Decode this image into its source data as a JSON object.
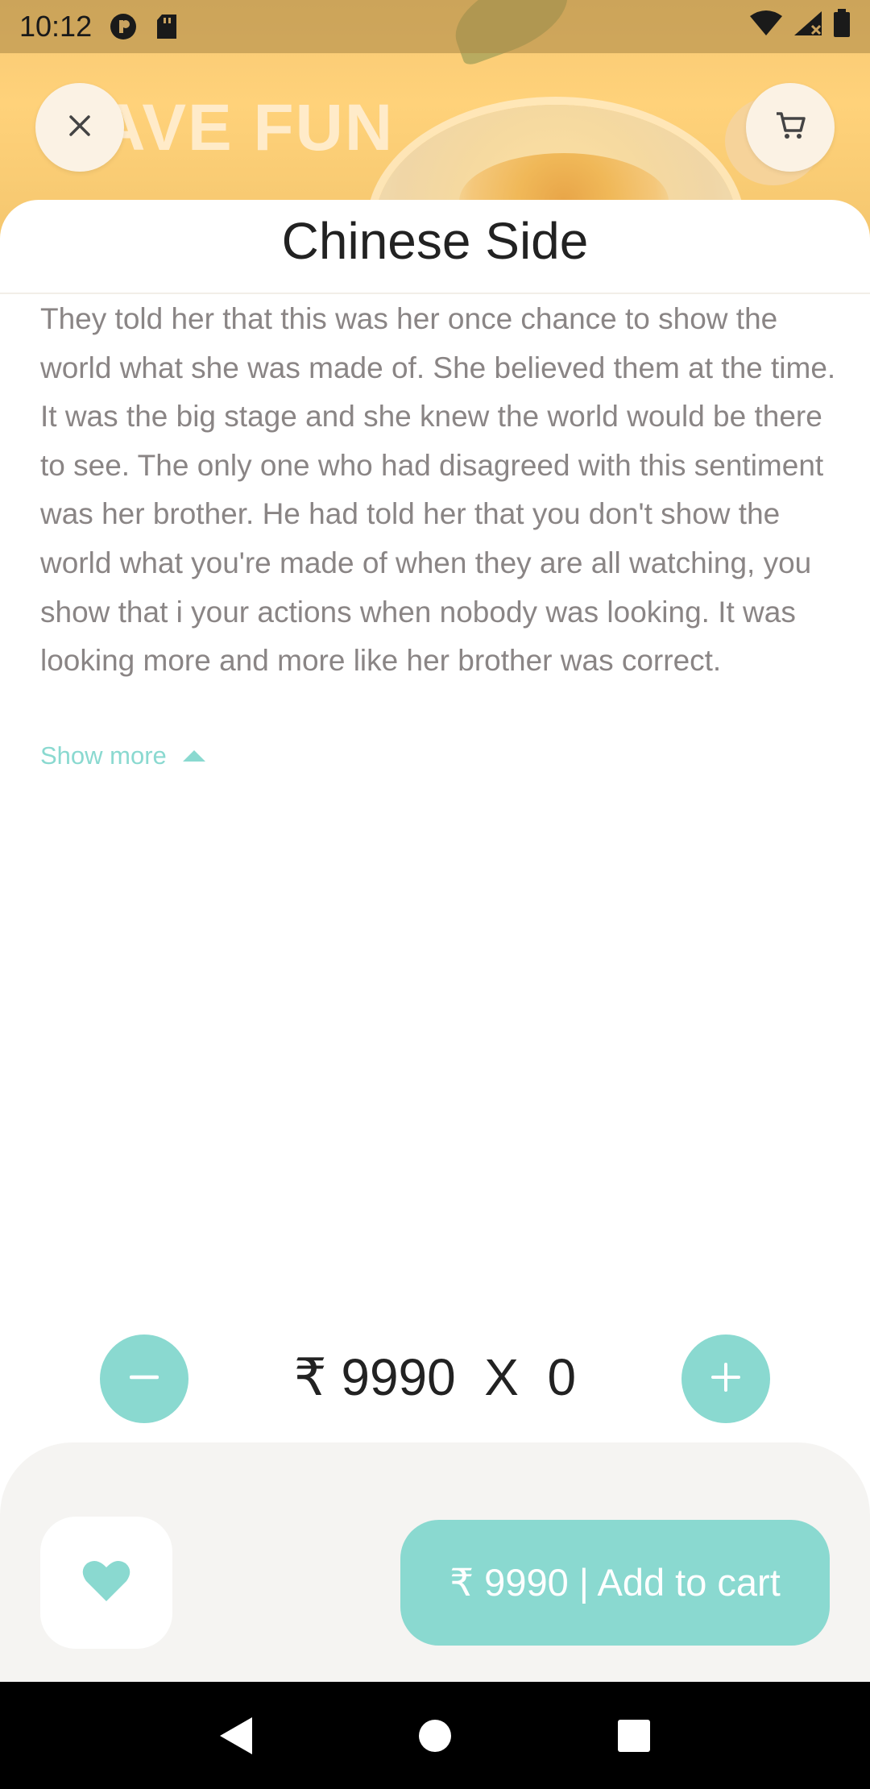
{
  "status_bar": {
    "time": "10:12",
    "icons_left": [
      "media-app-icon",
      "sd-card-icon"
    ],
    "icons_right": [
      "wifi-icon",
      "signal-icon",
      "battery-icon"
    ]
  },
  "header": {
    "close_icon": "close-icon",
    "cart_icon": "cart-icon",
    "hero_text": "HAVE FUN"
  },
  "product": {
    "title": "Chinese Side",
    "description": "They told her that this was her once chance to show the world what she was made of. She believed them at the time. It was the big stage and she knew the world would be there to see. The only one who had disagreed with this sentiment was her brother. He had told her that you don't show the world what you're made of when they are all watching, you show that i your actions when nobody was looking. It was looking more and more like her brother was correct.",
    "show_more_label": "Show more"
  },
  "quantity": {
    "text": "₹ 9990  X  0",
    "price": "9990",
    "count": 0
  },
  "actions": {
    "favorite_icon": "heart-icon",
    "add_to_cart_label": "₹ 9990 | Add to cart"
  },
  "colors": {
    "accent": "#8ad9d0",
    "hero_bg": "#ffd27a",
    "panel_bg": "#f5f4f2",
    "text_muted": "#8a8585"
  },
  "nav_bar": {
    "items": [
      "back-icon",
      "home-icon",
      "recents-icon"
    ]
  }
}
